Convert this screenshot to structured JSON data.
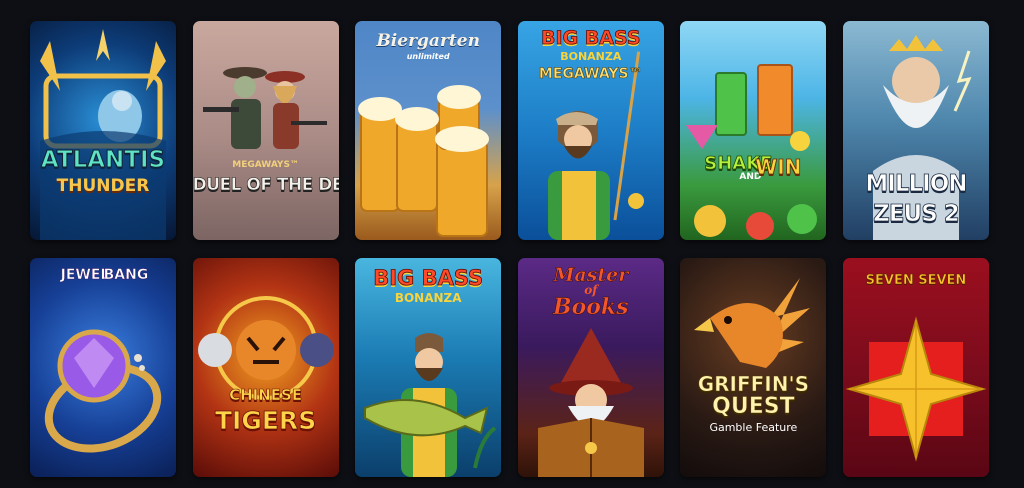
{
  "games": [
    {
      "name": "game-tile-atlantis-thunder",
      "title_line1": "ATLANTIS",
      "title_line2": "THUNDER"
    },
    {
      "name": "game-tile-duel-of-the-dead",
      "badge": "MEGAWAYS™",
      "title_line1": "DUEL OF THE DEAD"
    },
    {
      "name": "game-tile-biergarten-unlimited",
      "title_line1": "Biergarten",
      "title_line2": "unlimited"
    },
    {
      "name": "game-tile-big-bass-bonanza-megaways",
      "title_line1": "BIG BASS",
      "title_line2": "BONANZA",
      "title_line3": "MEGAWAYS™"
    },
    {
      "name": "game-tile-shake-and-win",
      "title_line1": "SHAKE",
      "title_line2": "AND",
      "title_line3": "WIN"
    },
    {
      "name": "game-tile-million-zeus-2",
      "title_line1": "MILLION",
      "title_line2": "ZEUS 2"
    },
    {
      "name": "game-tile-jewel-bang",
      "title_line1": "JEWEL",
      "title_line2": "BANG"
    },
    {
      "name": "game-tile-chinese-tigers",
      "title_line1": "CHINESE",
      "title_line2": "TIGERS"
    },
    {
      "name": "game-tile-big-bass-bonanza",
      "title_line1": "BIG BASS",
      "title_line2": "BONANZA"
    },
    {
      "name": "game-tile-master-of-books",
      "title_line1": "Master",
      "title_line2": "of",
      "title_line3": "Books"
    },
    {
      "name": "game-tile-griffins-quest",
      "title_line1": "GRIFFIN'S",
      "title_line2": "QUEST",
      "title_line3": "Gamble Feature"
    },
    {
      "name": "game-tile-seven-seven",
      "title_line1": "SEVEN SEVEN"
    }
  ]
}
